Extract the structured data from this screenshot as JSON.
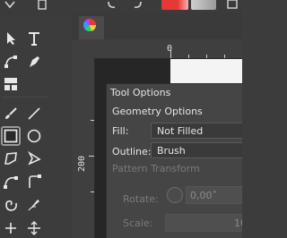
{
  "toolbar_colors": {
    "fg_swatch": "#e53935",
    "bg_swatch": "#d0d0d0"
  },
  "tools": [
    {
      "name": "pointer-tool-icon"
    },
    {
      "name": "text-tool-icon"
    },
    {
      "name": "node-edit-tool-icon"
    },
    {
      "name": "pen-tool-icon"
    },
    {
      "name": "pages-tool-icon"
    },
    {
      "name": "brush-tool-icon"
    },
    {
      "name": "line-tool-icon"
    },
    {
      "name": "rectangle-tool-icon"
    },
    {
      "name": "ellipse-tool-icon"
    },
    {
      "name": "polygon-tool-icon"
    },
    {
      "name": "triangle-tool-icon"
    },
    {
      "name": "arc-tool-icon"
    },
    {
      "name": "arrow-tool-icon"
    },
    {
      "name": "spiral-tool-icon"
    },
    {
      "name": "calligraphy-tool-icon"
    }
  ],
  "rulers": {
    "h_zero": "0",
    "v_label": "200"
  },
  "tool_options": {
    "title": "Tool Options",
    "section": "Geometry Options",
    "fill_label": "Fill:",
    "fill_value": "Not Filled",
    "outline_label": "Outline:",
    "outline_value": "Brush",
    "pattern_transform": "Pattern Transform",
    "rotate_label": "Rotate:",
    "rotate_value": "0,00˚",
    "scale_label": "Scale:",
    "scale_value": "10"
  }
}
